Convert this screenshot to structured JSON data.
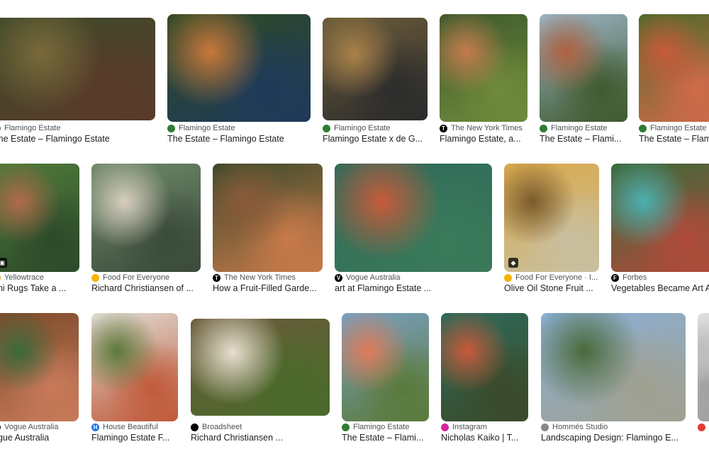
{
  "results": [
    {
      "source": "Flamingo Estate",
      "title": "The Estate – Flamingo Estate",
      "fav_color": "#2e7d32",
      "fav": "icon"
    },
    {
      "source": "Flamingo Estate",
      "title": "The Estate – Flamingo Estate",
      "fav_color": "#2e7d32",
      "fav": "icon"
    },
    {
      "source": "Flamingo Estate",
      "title": "Flamingo Estate x de G...",
      "fav_color": "#2e7d32",
      "fav": "icon"
    },
    {
      "source": "The New York Times",
      "title": "Flamingo Estate, a...",
      "fav_color": "#000000",
      "fav": "T"
    },
    {
      "source": "Flamingo Estate",
      "title": "The Estate – Flami...",
      "fav_color": "#2e7d32",
      "fav": "icon"
    },
    {
      "source": "Flamingo Estate",
      "title": "The Estate – Flam",
      "fav_color": "#2e7d32",
      "fav": "icon"
    },
    {
      "source": "Yellowtrace",
      "title": "eni Rugs Take a ...",
      "fav_color": "#d4a000",
      "fav": "icon"
    },
    {
      "source": "Food For Everyone",
      "title": "Richard Christiansen of ...",
      "fav_color": "#f4b400",
      "fav": "icon"
    },
    {
      "source": "The New York Times",
      "title": "How a Fruit-Filled Garde...",
      "fav_color": "#000000",
      "fav": "T"
    },
    {
      "source": "Vogue Australia",
      "title": "art at Flamingo Estate ...",
      "fav_color": "#000000",
      "fav": "V"
    },
    {
      "source": "Food For Everyone · I...",
      "title": "Olive Oil Stone Fruit ...",
      "fav_color": "#f4b400",
      "fav": "icon"
    },
    {
      "source": "Forbes",
      "title": "Vegetables Became Art A",
      "fav_color": "#000000",
      "fav": "F"
    },
    {
      "source": "Vogue Australia",
      "title": "ogue Australia",
      "fav_color": "#000000",
      "fav": "V"
    },
    {
      "source": "House Beautiful",
      "title": "Flamingo Estate F...",
      "fav_color": "#1a73e8",
      "fav": "HB"
    },
    {
      "source": "Broadsheet",
      "title": "Richard Christiansen ...",
      "fav_color": "#000000",
      "fav": "icon"
    },
    {
      "source": "Flamingo Estate",
      "title": "The Estate – Flami...",
      "fav_color": "#2e7d32",
      "fav": "icon"
    },
    {
      "source": "Instagram",
      "title": "Nicholas Kaiko | T...",
      "fav_color": "#d6249f",
      "fav": "icon"
    },
    {
      "source": "Hommés Studio",
      "title": "Landscaping Design: Flamingo E...",
      "fav_color": "#888888",
      "fav": "icon"
    },
    {
      "source": "",
      "title": "",
      "fav_color": "#e53935",
      "fav": "icon"
    }
  ],
  "icons": {
    "image_badge": "image-icon",
    "tag_badge": "tag-icon"
  }
}
